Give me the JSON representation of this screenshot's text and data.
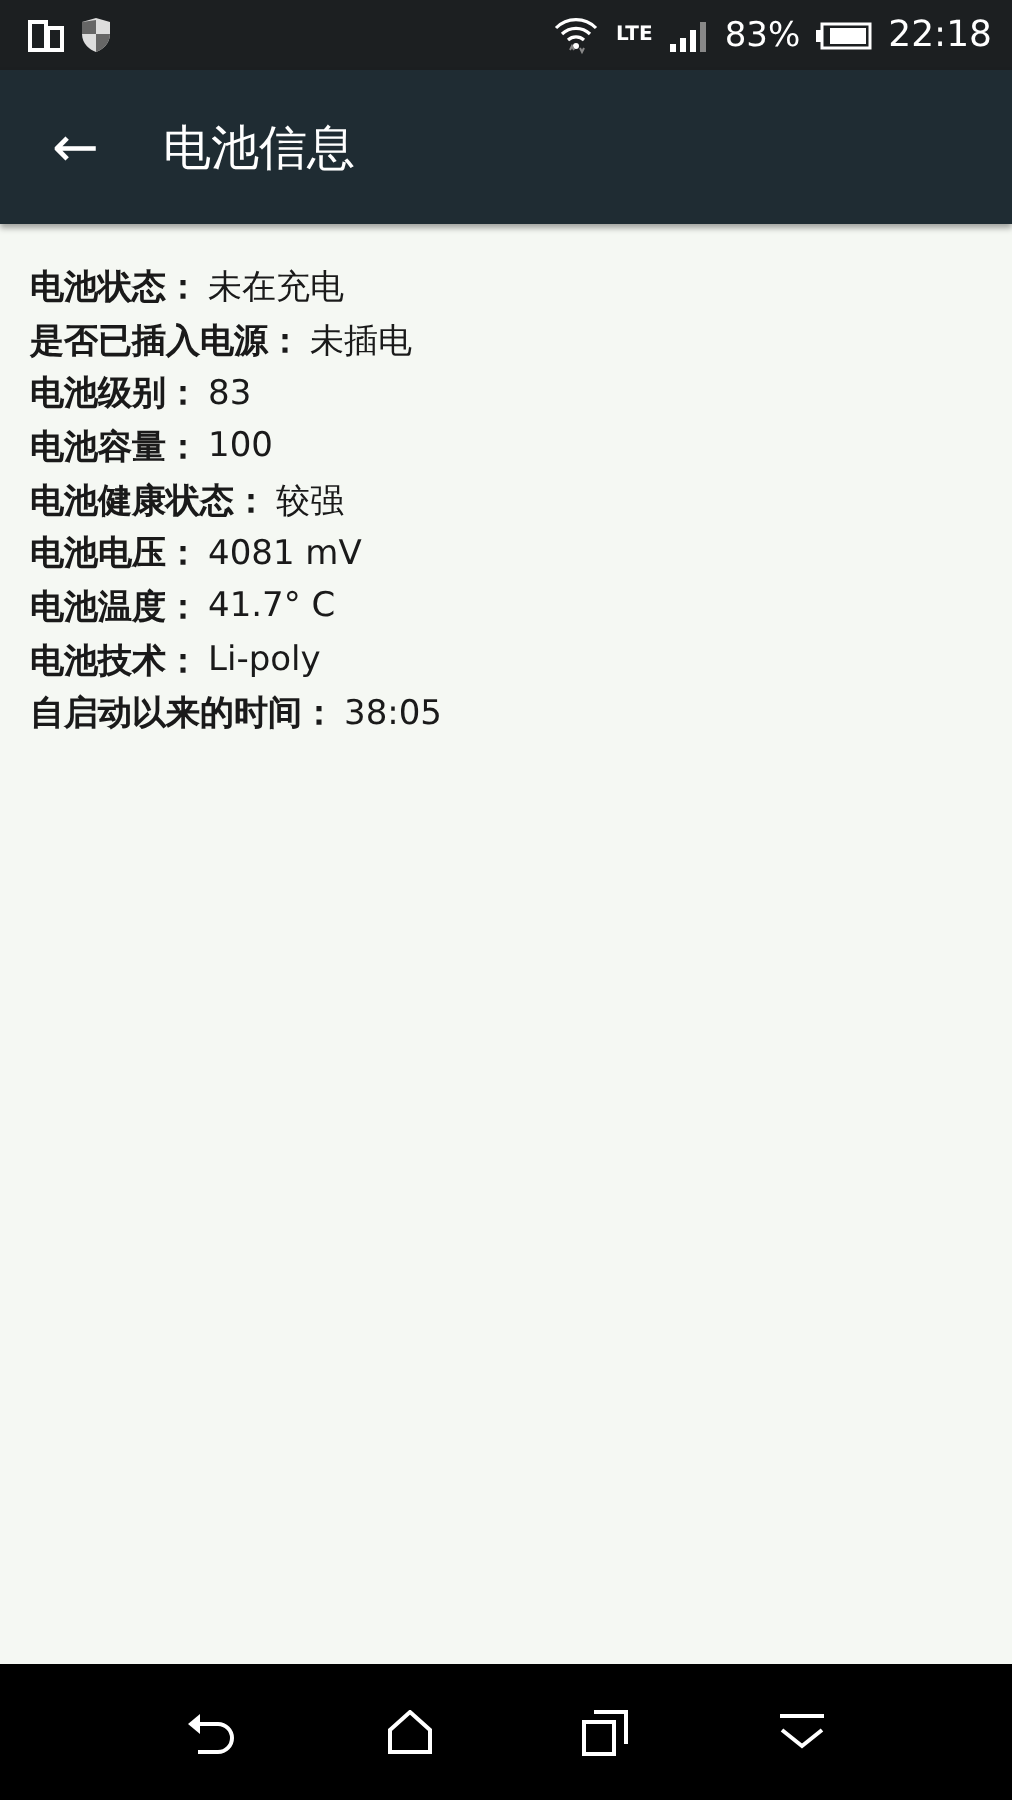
{
  "status_bar": {
    "network": "LTE",
    "battery_percent": "83%",
    "time": "22:18"
  },
  "app_bar": {
    "back": "←",
    "title": "电池信息"
  },
  "rows": [
    {
      "label": "电池状态：",
      "value": "未在充电"
    },
    {
      "label": "是否已插入电源：",
      "value": "未插电"
    },
    {
      "label": "电池级别：",
      "value": "83"
    },
    {
      "label": "电池容量：",
      "value": "100"
    },
    {
      "label": "电池健康状态：",
      "value": "较强"
    },
    {
      "label": "电池电压：",
      "value": "4081 mV"
    },
    {
      "label": "电池温度：",
      "value": "41.7° C"
    },
    {
      "label": "电池技术：",
      "value": "Li-poly"
    },
    {
      "label": "自启动以来的时间：",
      "value": "38:05"
    }
  ]
}
